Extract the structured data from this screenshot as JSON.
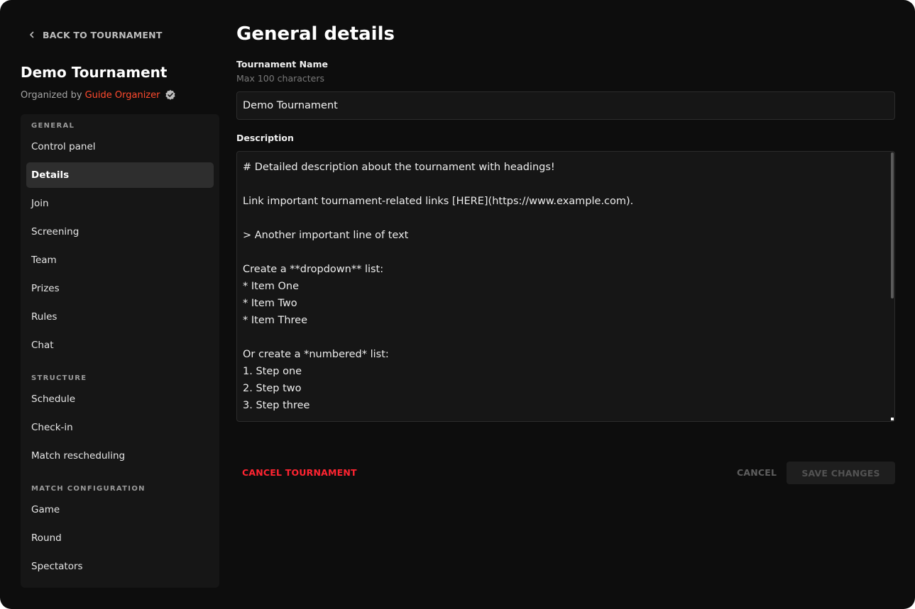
{
  "sidebar": {
    "back_label": "BACK TO TOURNAMENT",
    "tournament_name": "Demo Tournament",
    "organized_by": "Organized by",
    "organizer_name": "Guide Organizer",
    "sections": [
      {
        "title": "GENERAL",
        "items": [
          "Control panel",
          "Details",
          "Join",
          "Screening",
          "Team",
          "Prizes",
          "Rules",
          "Chat"
        ]
      },
      {
        "title": "STRUCTURE",
        "items": [
          "Schedule",
          "Check-in",
          "Match rescheduling"
        ]
      },
      {
        "title": "MATCH CONFIGURATION",
        "items": [
          "Game",
          "Round",
          "Spectators"
        ]
      }
    ],
    "active_item": "Details"
  },
  "main": {
    "title": "General details",
    "name_field": {
      "label": "Tournament Name",
      "hint": "Max 100 characters",
      "value": "Demo Tournament"
    },
    "description_field": {
      "label": "Description",
      "lines": [
        "# Detailed description about the tournament with headings!",
        "",
        "Link important tournament-related links [HERE](https://www.example.com).",
        "",
        "> Another important line of text",
        "",
        "Create a **dropdown** list:",
        "* Item One",
        "* Item Two",
        "* Item Three",
        "",
        "Or create a *numbered* list:",
        "1. Step one",
        "2. Step two",
        "3. Step three"
      ]
    },
    "actions": {
      "cancel_tournament": "CANCEL TOURNAMENT",
      "cancel": "CANCEL",
      "save": "SAVE CHANGES"
    }
  },
  "colors": {
    "accent_orange": "#ff4a2e",
    "danger_red": "#ff2431",
    "background": "#0d0d0d",
    "panel": "#161616"
  },
  "icons": {
    "back": "chevron-left-icon",
    "verified": "verified-badge-icon"
  }
}
